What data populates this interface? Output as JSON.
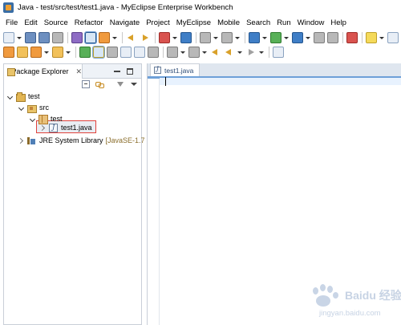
{
  "window": {
    "title": "Java - test/src/test/test1.java - MyEclipse Enterprise Workbench"
  },
  "menubar": {
    "items": [
      "File",
      "Edit",
      "Source",
      "Refactor",
      "Navigate",
      "Project",
      "MyEclipse",
      "Mobile",
      "Search",
      "Run",
      "Window",
      "Help"
    ]
  },
  "package_explorer": {
    "tab_label": "Package Explorer",
    "close_glyph": "✕",
    "tree": [
      {
        "label": "test",
        "icon": "project-icon",
        "expanded": true
      },
      {
        "label": "src",
        "icon": "source-folder-icon",
        "expanded": true
      },
      {
        "label": "test",
        "icon": "package-icon",
        "expanded": true
      },
      {
        "label": "test1.java",
        "icon": "java-file-icon",
        "expanded": false,
        "selected": true
      },
      {
        "label": "JRE System Library",
        "decoration": "[JavaSE-1.7",
        "icon": "library-icon",
        "expanded": false
      }
    ]
  },
  "editor": {
    "tab_label": "test1.java",
    "current_line_color": "#e8f2fe",
    "tab_strip_color": "#6ea0d8"
  },
  "watermark": {
    "brand": "Baidu 经验",
    "url": "jingyan.baidu.com"
  },
  "colors": {
    "selection_outline": "#e0423c",
    "panel_border": "#c9cfd8"
  }
}
